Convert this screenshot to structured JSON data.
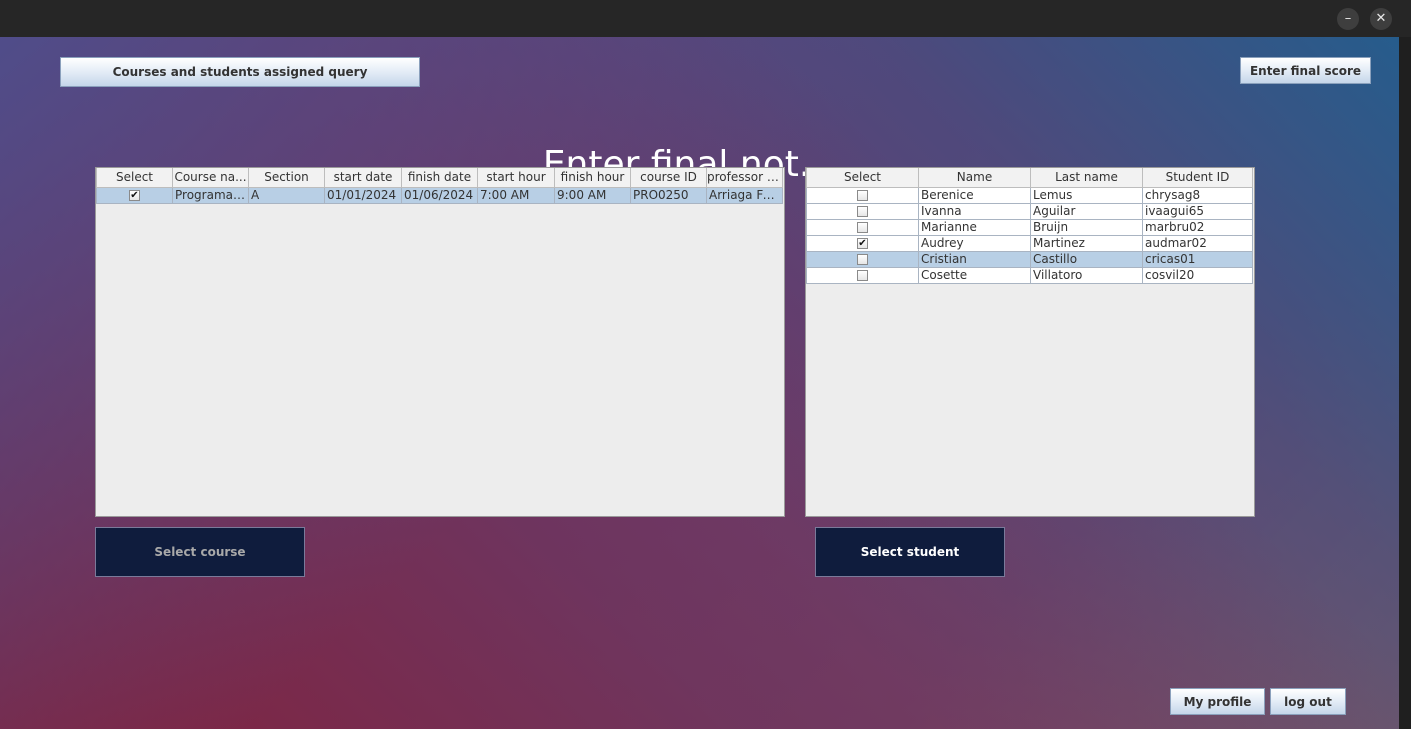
{
  "window": {
    "minimize_glyph": "–",
    "close_glyph": "✕"
  },
  "top_buttons": {
    "query_label": "Courses and students assigned query",
    "final_score_label": "Enter final score"
  },
  "heading": "Enter final not...",
  "courses_table": {
    "columns": [
      "Select",
      "Course na...",
      "Section",
      "start date",
      "finish date",
      "start hour",
      "finish hour",
      "course ID",
      "professor a..."
    ],
    "rows": [
      {
        "checked": true,
        "selected": true,
        "course_name": "Programac...",
        "section": "A",
        "start_date": "01/01/2024",
        "finish_date": "01/06/2024",
        "start_hour": "7:00 AM",
        "finish_hour": "9:00 AM",
        "course_id": "PRO0250",
        "professor": "Arriaga Fer..."
      }
    ]
  },
  "students_table": {
    "columns": [
      "Select",
      "Name",
      "Last name",
      "Student ID"
    ],
    "rows": [
      {
        "checked": false,
        "selected": false,
        "name": "Berenice",
        "last_name": "Lemus",
        "student_id": "chrysag8"
      },
      {
        "checked": false,
        "selected": false,
        "name": "Ivanna",
        "last_name": "Aguilar",
        "student_id": "ivaagui65"
      },
      {
        "checked": false,
        "selected": false,
        "name": "Marianne",
        "last_name": "Bruijn",
        "student_id": "marbru02"
      },
      {
        "checked": true,
        "selected": false,
        "name": "Audrey",
        "last_name": "Martinez",
        "student_id": "audmar02"
      },
      {
        "checked": false,
        "selected": true,
        "name": "Cristian",
        "last_name": "Castillo",
        "student_id": "cricas01"
      },
      {
        "checked": false,
        "selected": false,
        "name": "Cosette",
        "last_name": "Villatoro",
        "student_id": "cosvil20"
      }
    ]
  },
  "action_buttons": {
    "select_course_label": "Select course",
    "select_student_label": "Select student"
  },
  "bottom_buttons": {
    "my_profile_label": "My profile",
    "logout_label": "log out"
  },
  "colors": {
    "dark_button": "#0f1c3d",
    "selection_row": "#b8cfe5",
    "disabled_text": "#a9a9a9",
    "enabled_text": "#ffffff"
  }
}
